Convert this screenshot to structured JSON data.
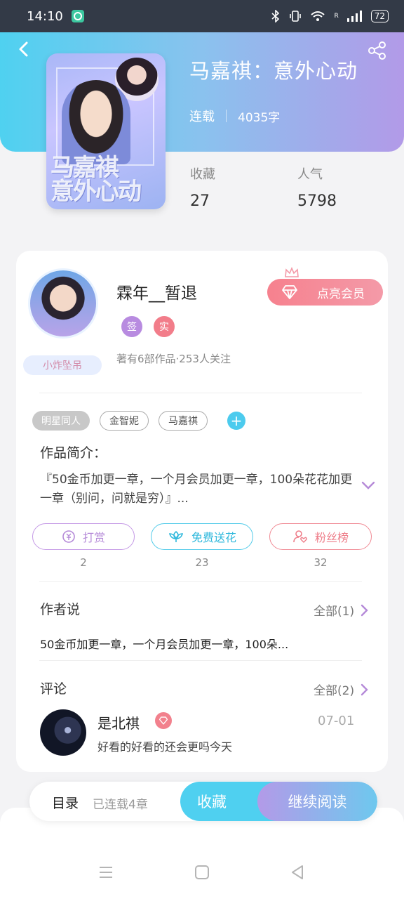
{
  "status_bar": {
    "time": "14:10",
    "battery": "72",
    "signal_label": "R"
  },
  "book": {
    "title": "马嘉祺：意外心动",
    "status": "连载",
    "word_count": "4035字",
    "cover_text": "马嘉祺\n意外心动",
    "favorites_label": "收藏",
    "favorites": "27",
    "popularity_label": "人气",
    "popularity": "5798"
  },
  "author": {
    "name": "霖年__暂退",
    "badges": [
      "签",
      "实"
    ],
    "avatar_tag": "小炸坠吊",
    "stats": "著有6部作品·253人关注",
    "vip_button": "点亮会员"
  },
  "tags": [
    "明星同人",
    "金智妮",
    "马嘉祺"
  ],
  "intro": {
    "label": "作品简介：",
    "text": "『50金币加更一章，一个月会员加更一章，100朵花花加更一章（别问，问就是穷）』..."
  },
  "actions": [
    {
      "label": "打赏",
      "count": "2"
    },
    {
      "label": "免费送花",
      "count": "23"
    },
    {
      "label": "粉丝榜",
      "count": "32"
    }
  ],
  "author_says": {
    "label": "作者说",
    "more": "全部(1)",
    "text": "50金币加更一章，一个月会员加更一章，100朵..."
  },
  "comments": {
    "label": "评论",
    "more": "全部(2)",
    "items": [
      {
        "user": "是北祺",
        "date": "07-01",
        "text": "好看的好看的还会更吗今天"
      }
    ]
  },
  "bottom_bar": {
    "toc": "目录",
    "toc_status": "已连载4章",
    "favorite": "收藏",
    "continue": "继续阅读"
  },
  "colors": {
    "header_start": "#4fd1f0",
    "header_end": "#b29ae8",
    "vip": "#f6818e",
    "cyan": "#4fd0f0",
    "purple": "#b39ae8"
  }
}
